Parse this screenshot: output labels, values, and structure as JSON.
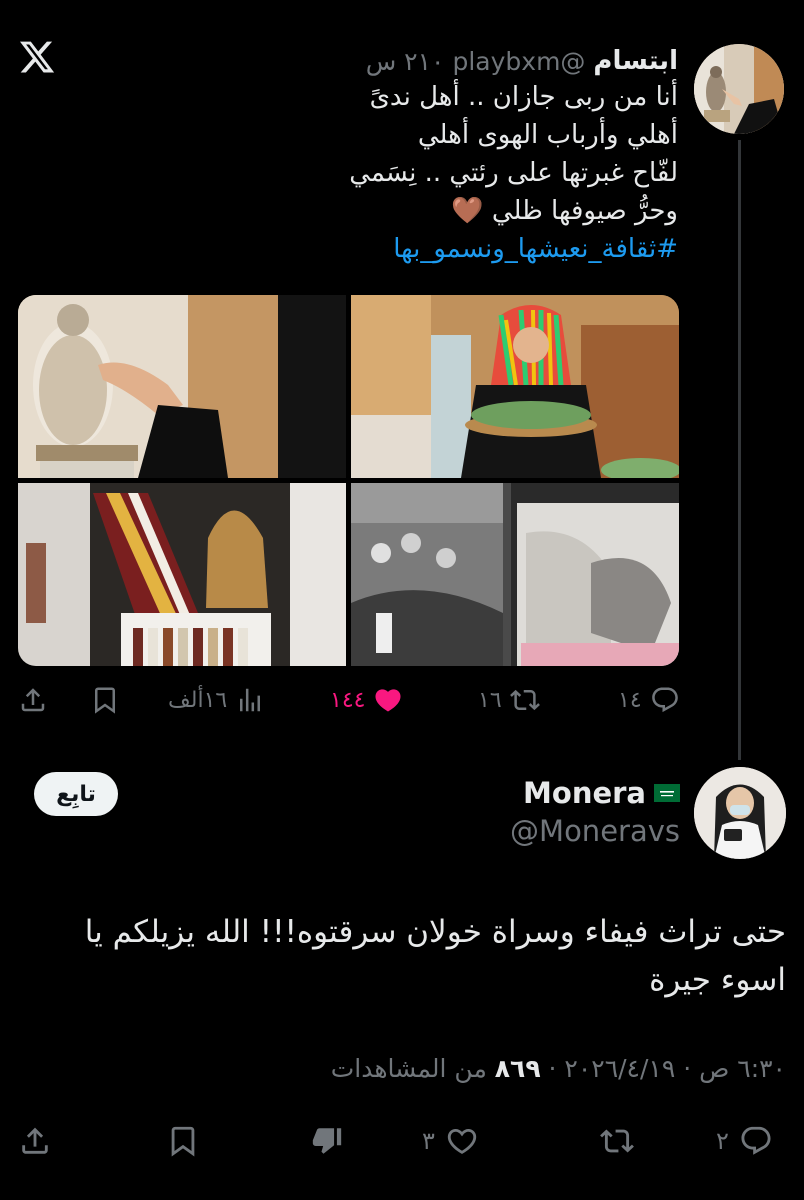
{
  "tweet": {
    "name": "ابتسام",
    "handle": "@playbxm",
    "time": "٢١٠ س",
    "lines": [
      "أنا من ربى جازان .. أهل ندىً",
      "أهلي وأرباب الهوى أهلي",
      "لفّاح غبرتها على رئتي .. نِسَمي",
      "وحرُّ صيوفها ظلي 🤎"
    ],
    "hashtag": "#ثقافة_نعيشها_ونسمو_بها",
    "stats": {
      "replies": "١٤",
      "retweets": "١٦",
      "likes": "١٤٤",
      "views": "١٦ألف"
    }
  },
  "reply": {
    "name": "Monera",
    "handle": "@Moneravs",
    "follow_label": "تابِع",
    "text": "حتى تراث فيفاء وسراة خولان سرقتوه!!! الله يزيلكم يا اسوء جيرة",
    "meta_prefix": "٦:٣٠ ص · ٢٠٢٦/٤/١٩ · ",
    "views": "٨٦٩",
    "meta_suffix": " من المشاهدات",
    "stats": {
      "replies": "٢",
      "likes": "٣"
    }
  },
  "colors": {
    "accent": "#1d9bf0",
    "like": "#f91880",
    "muted": "#71767b"
  }
}
